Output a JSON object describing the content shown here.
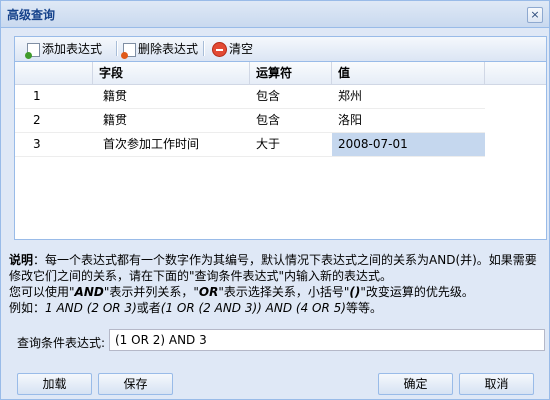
{
  "window": {
    "title": "高级查询"
  },
  "toolbar": {
    "add": "添加表达式",
    "delete": "删除表达式",
    "clear": "清空"
  },
  "grid": {
    "headers": [
      "",
      "字段",
      "运算符",
      "值"
    ],
    "rows": [
      {
        "no": "1",
        "field": "籍贯",
        "op": "包含",
        "value": "郑州"
      },
      {
        "no": "2",
        "field": "籍贯",
        "op": "包含",
        "value": "洛阳"
      },
      {
        "no": "3",
        "field": "首次参加工作时间",
        "op": "大于",
        "value": "2008-07-01"
      }
    ]
  },
  "desc": {
    "label": "说明",
    "line1": "：每一个表达式都有一个数字作为其编号，默认情况下表达式之间的关系为AND(并)。如果需要修改它们之间的关系，请在下面的\"查询条件表达式\"内输入新的表达式。",
    "l2a": "您可以使用\"",
    "and": "AND",
    "l2b": "\"表示并列关系，\"",
    "or": "OR",
    "l2c": "\"表示选择关系，小括号\"",
    "paren": "()",
    "l2d": "\"改变运算的优先级。",
    "l3a": "例如：",
    "ex1": "1 AND (2 OR 3)",
    "l3b": "或者",
    "ex2": "(1 OR (2 AND 3)) AND (4 OR 5)",
    "l3c": "等等。"
  },
  "expr": {
    "label": "查询条件表达式:",
    "value": "(1 OR 2) AND 3"
  },
  "buttons": {
    "load": "加载",
    "save": "保存",
    "ok": "确定",
    "cancel": "取消"
  }
}
